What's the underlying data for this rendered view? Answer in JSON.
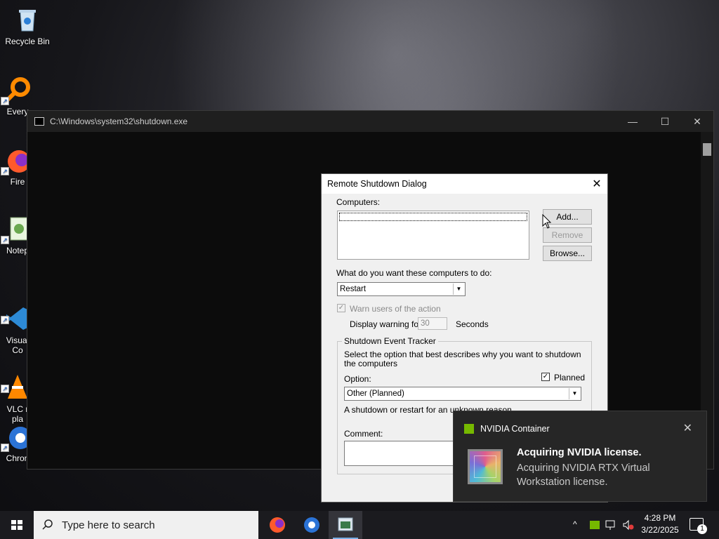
{
  "desktop": {
    "icons": [
      {
        "label": "Recycle Bin"
      },
      {
        "label": "Every"
      },
      {
        "label": "Fire"
      },
      {
        "label": "Notep"
      },
      {
        "label": "Visual\nCo"
      },
      {
        "label": "VLC r\npla"
      },
      {
        "label": "Chron"
      }
    ]
  },
  "console": {
    "title": "C:\\Windows\\system32\\shutdown.exe",
    "minimize": "—",
    "maximize": "☐",
    "close": "✕"
  },
  "dialog": {
    "title": "Remote Shutdown Dialog",
    "close": "✕",
    "computers_label": "Computers:",
    "add_button": "Add...",
    "remove_button": "Remove",
    "browse_button": "Browse...",
    "action_label": "What do you want these computers to do:",
    "action_value": "Restart",
    "warn_label": "Warn users of the action",
    "warn_checked": "✓",
    "display_warning_label": "Display warning for",
    "warning_seconds": "30",
    "seconds_label": "Seconds",
    "tracker_title": "Shutdown Event Tracker",
    "tracker_desc": "Select the option that best describes why you want to shutdown the computers",
    "planned_label": "Planned",
    "planned_checked": "✓",
    "option_label": "Option:",
    "option_value": "Other (Planned)",
    "reason_desc": "A shutdown or restart for an unknown reason",
    "comment_label": "Comment:"
  },
  "toast": {
    "app_name": "NVIDIA Container",
    "close": "✕",
    "heading": "Acquiring NVIDIA license.",
    "body": "Acquiring NVIDIA RTX Virtual Workstation license."
  },
  "taskbar": {
    "search_placeholder": "Type here to search",
    "time": "4:28 PM",
    "date": "3/22/2025",
    "notification_count": "1",
    "chevron": "^"
  }
}
